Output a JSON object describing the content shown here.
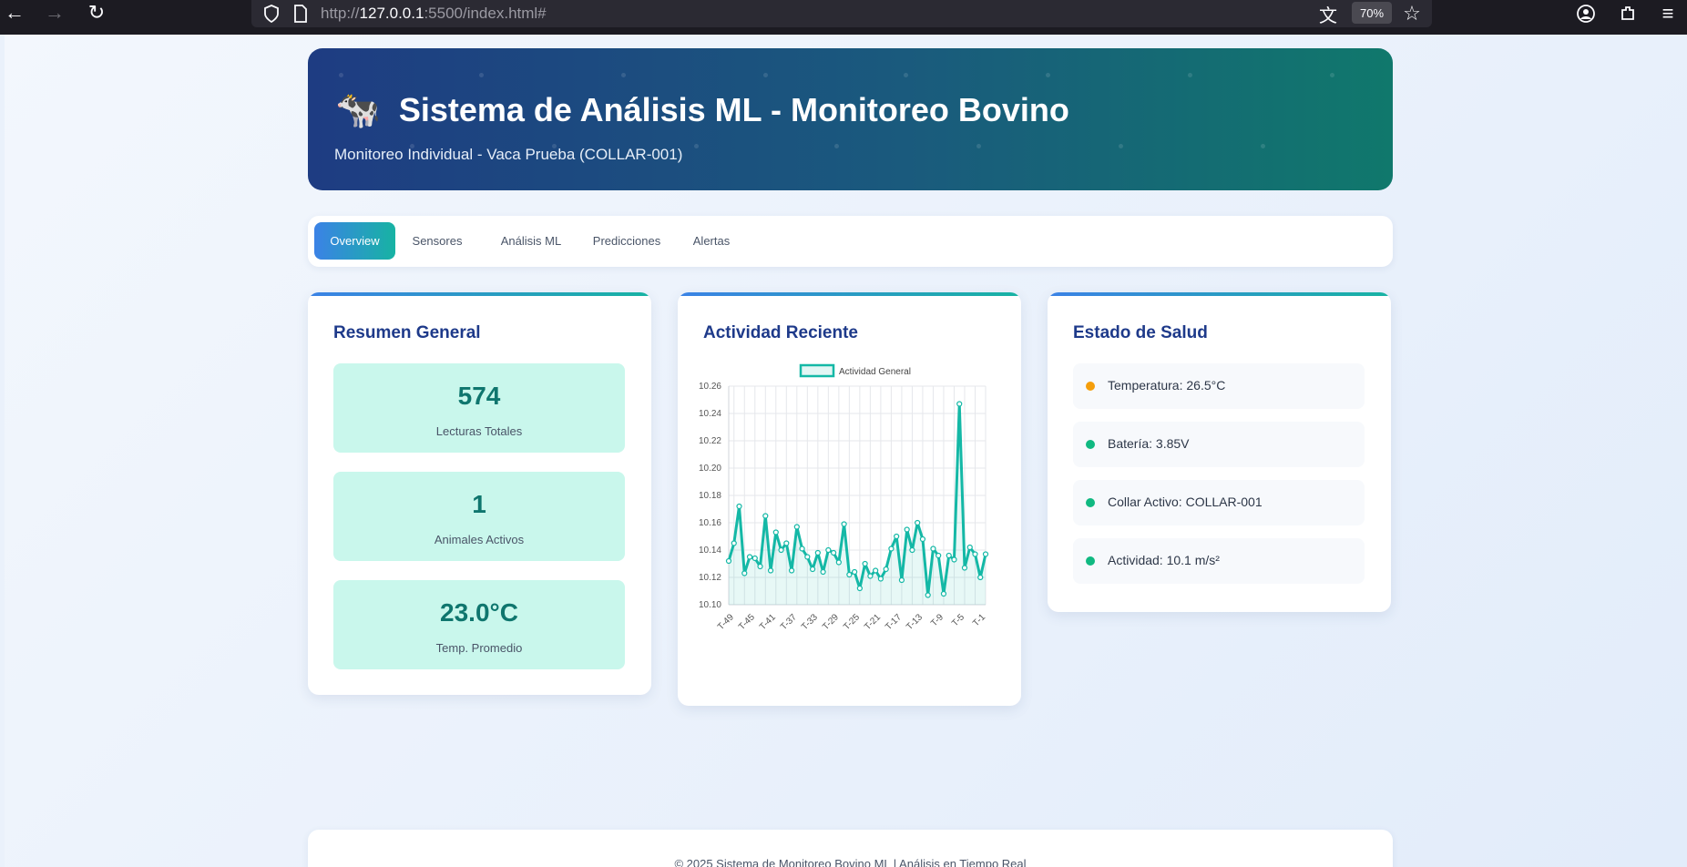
{
  "browser": {
    "url_scheme": "http://",
    "url_host": "127.0.0.1",
    "url_rest": ":5500/index.html#",
    "zoom": "70%"
  },
  "header": {
    "icon": "🐄",
    "title": "Sistema de Análisis ML - Monitoreo Bovino",
    "subtitle": "Monitoreo Individual - Vaca Prueba (COLLAR-001)"
  },
  "tabs": [
    {
      "label": "Overview",
      "active": true
    },
    {
      "label": "Sensores",
      "active": false
    },
    {
      "label": "Análisis ML",
      "active": false
    },
    {
      "label": "Predicciones",
      "active": false
    },
    {
      "label": "Alertas",
      "active": false
    }
  ],
  "summary": {
    "title": "Resumen General",
    "stats": [
      {
        "value": "574",
        "label": "Lecturas Totales"
      },
      {
        "value": "1",
        "label": "Animales Activos"
      },
      {
        "value": "23.0°C",
        "label": "Temp. Promedio"
      }
    ]
  },
  "activity": {
    "title": "Actividad Reciente"
  },
  "health": {
    "title": "Estado de Salud",
    "items": [
      {
        "text": "Temperatura: 26.5°C",
        "color": "#f59e0b"
      },
      {
        "text": "Batería: 3.85V",
        "color": "#10b981"
      },
      {
        "text": "Collar Activo: COLLAR-001",
        "color": "#10b981"
      },
      {
        "text": "Actividad: 10.1 m/s²",
        "color": "#10b981"
      }
    ]
  },
  "footer": {
    "text": "© 2025 Sistema de Monitoreo Bovino ML | Análisis en Tiempo Real"
  },
  "chart_data": {
    "type": "line",
    "title": "",
    "xlabel": "",
    "ylabel": "",
    "ylim": [
      10.1,
      10.26
    ],
    "yticks": [
      "10.26",
      "10.24",
      "10.22",
      "10.20",
      "10.18",
      "10.16",
      "10.14",
      "10.12",
      "10.10"
    ],
    "xtick_labels": [
      "T-49",
      "T-45",
      "T-41",
      "T-37",
      "T-33",
      "T-29",
      "T-25",
      "T-21",
      "T-17",
      "T-13",
      "T-9",
      "T-5",
      "T-1"
    ],
    "grid": true,
    "legend": "top-center",
    "color": "#14b8a6",
    "series": [
      {
        "name": "Actividad General",
        "x": [
          "T-50",
          "T-49",
          "T-48",
          "T-47",
          "T-46",
          "T-45",
          "T-44",
          "T-43",
          "T-42",
          "T-41",
          "T-40",
          "T-39",
          "T-38",
          "T-37",
          "T-36",
          "T-35",
          "T-34",
          "T-33",
          "T-32",
          "T-31",
          "T-30",
          "T-29",
          "T-28",
          "T-27",
          "T-26",
          "T-25",
          "T-24",
          "T-23",
          "T-22",
          "T-21",
          "T-20",
          "T-19",
          "T-18",
          "T-17",
          "T-16",
          "T-15",
          "T-14",
          "T-13",
          "T-12",
          "T-11",
          "T-10",
          "T-9",
          "T-8",
          "T-7",
          "T-6",
          "T-5",
          "T-4",
          "T-3",
          "T-2",
          "T-1"
        ],
        "values": [
          10.132,
          10.145,
          10.172,
          10.123,
          10.135,
          10.134,
          10.128,
          10.165,
          10.125,
          10.153,
          10.14,
          10.145,
          10.125,
          10.157,
          10.141,
          10.135,
          10.126,
          10.138,
          10.124,
          10.14,
          10.138,
          10.131,
          10.159,
          10.122,
          10.124,
          10.112,
          10.13,
          10.121,
          10.125,
          10.119,
          10.126,
          10.141,
          10.15,
          10.118,
          10.155,
          10.14,
          10.16,
          10.148,
          10.107,
          10.141,
          10.136,
          10.108,
          10.136,
          10.133,
          10.247,
          10.127,
          10.142,
          10.137,
          10.12,
          10.137
        ]
      }
    ]
  }
}
